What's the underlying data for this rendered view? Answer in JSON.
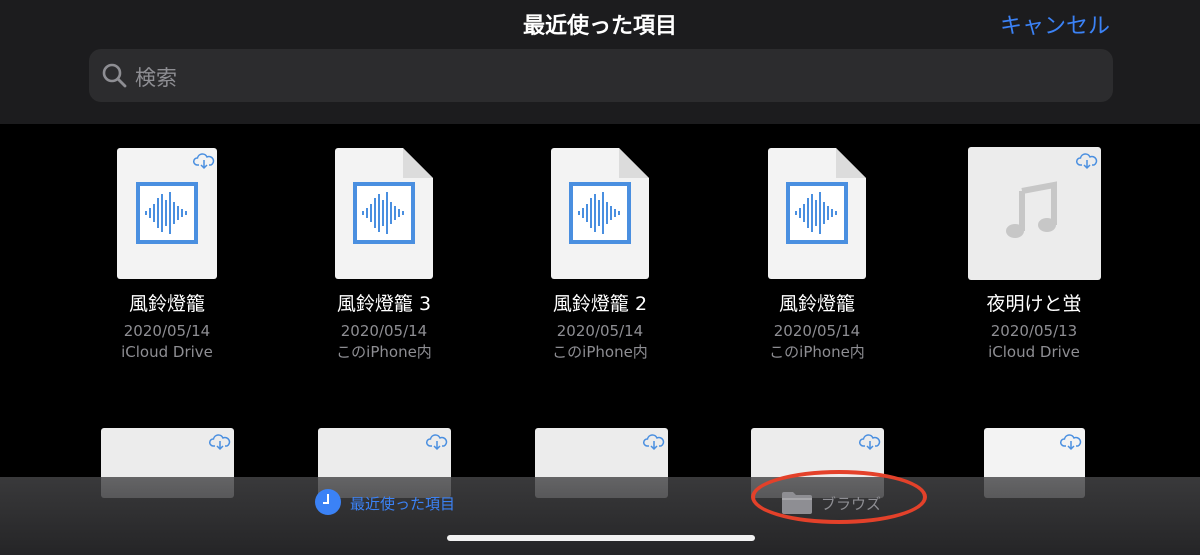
{
  "header": {
    "title": "最近使った項目",
    "cancel_label": "キャンセル"
  },
  "search": {
    "placeholder": "検索",
    "icon": "search-icon"
  },
  "files": [
    {
      "name": "風鈴燈籠",
      "date": "2020/05/14",
      "location": "iCloud Drive",
      "kind": "audio",
      "cloud": true
    },
    {
      "name": "風鈴燈籠 3",
      "date": "2020/05/14",
      "location": "このiPhone内",
      "kind": "audio",
      "cloud": false
    },
    {
      "name": "風鈴燈籠 2",
      "date": "2020/05/14",
      "location": "このiPhone内",
      "kind": "audio",
      "cloud": false
    },
    {
      "name": "風鈴燈籠",
      "date": "2020/05/14",
      "location": "このiPhone内",
      "kind": "audio",
      "cloud": false
    },
    {
      "name": "夜明けと蛍",
      "date": "2020/05/13",
      "location": "iCloud Drive",
      "kind": "music",
      "cloud": true
    }
  ],
  "tabbar": {
    "recent_label": "最近使った項目",
    "browse_label": "ブラウズ",
    "recent_color": "#3b82f6",
    "browse_color": "#8e8e93"
  },
  "colors": {
    "accent": "#3b82f6",
    "annotation_ring": "#e3412a"
  }
}
